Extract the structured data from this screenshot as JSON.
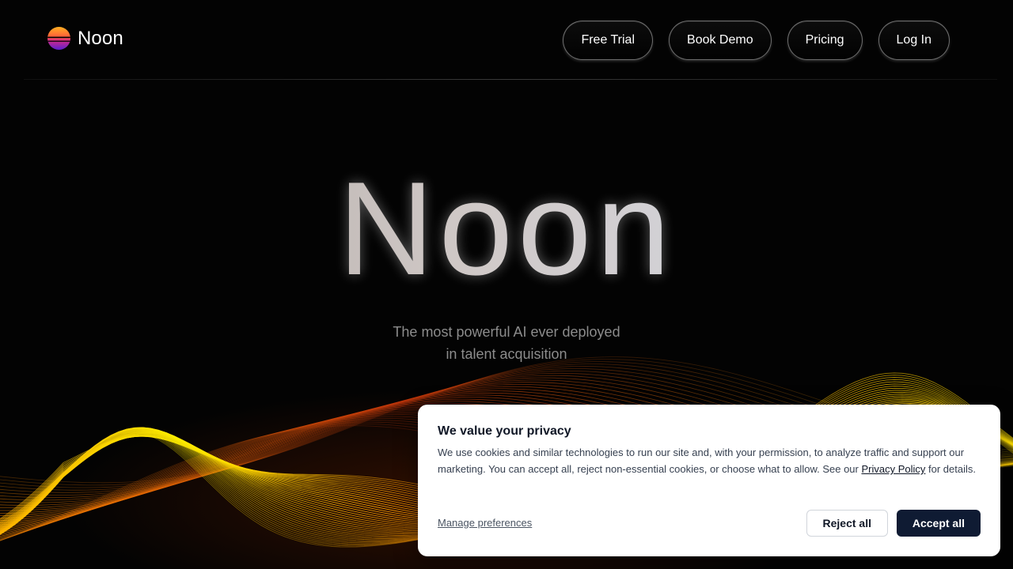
{
  "brand": {
    "name": "Noon",
    "logo_icon": "sunset-logo-icon"
  },
  "nav": {
    "items": [
      {
        "label": "Free Trial"
      },
      {
        "label": "Book Demo"
      },
      {
        "label": "Pricing"
      },
      {
        "label": "Log In"
      }
    ]
  },
  "hero": {
    "title": "Noon",
    "subtitle_line1": "The most powerful AI ever deployed",
    "subtitle_line2": "in talent acquisition"
  },
  "cookie_banner": {
    "title": "We value your privacy",
    "body_before_link": "We use cookies and similar technologies to run our site and, with your permission, to analyze traffic and support our marketing. You can accept all, reject non-essential cookies, or choose what to allow. See our ",
    "link_label": "Privacy Policy",
    "body_after_link": " for details.",
    "manage_label": "Manage preferences",
    "reject_label": "Reject all",
    "accept_label": "Accept all"
  },
  "colors": {
    "background": "#030303",
    "wave_yellow": "#ffe600",
    "wave_orange": "#ff6a00",
    "wave_red": "#b52a00",
    "accept_button": "#0f1b33"
  }
}
